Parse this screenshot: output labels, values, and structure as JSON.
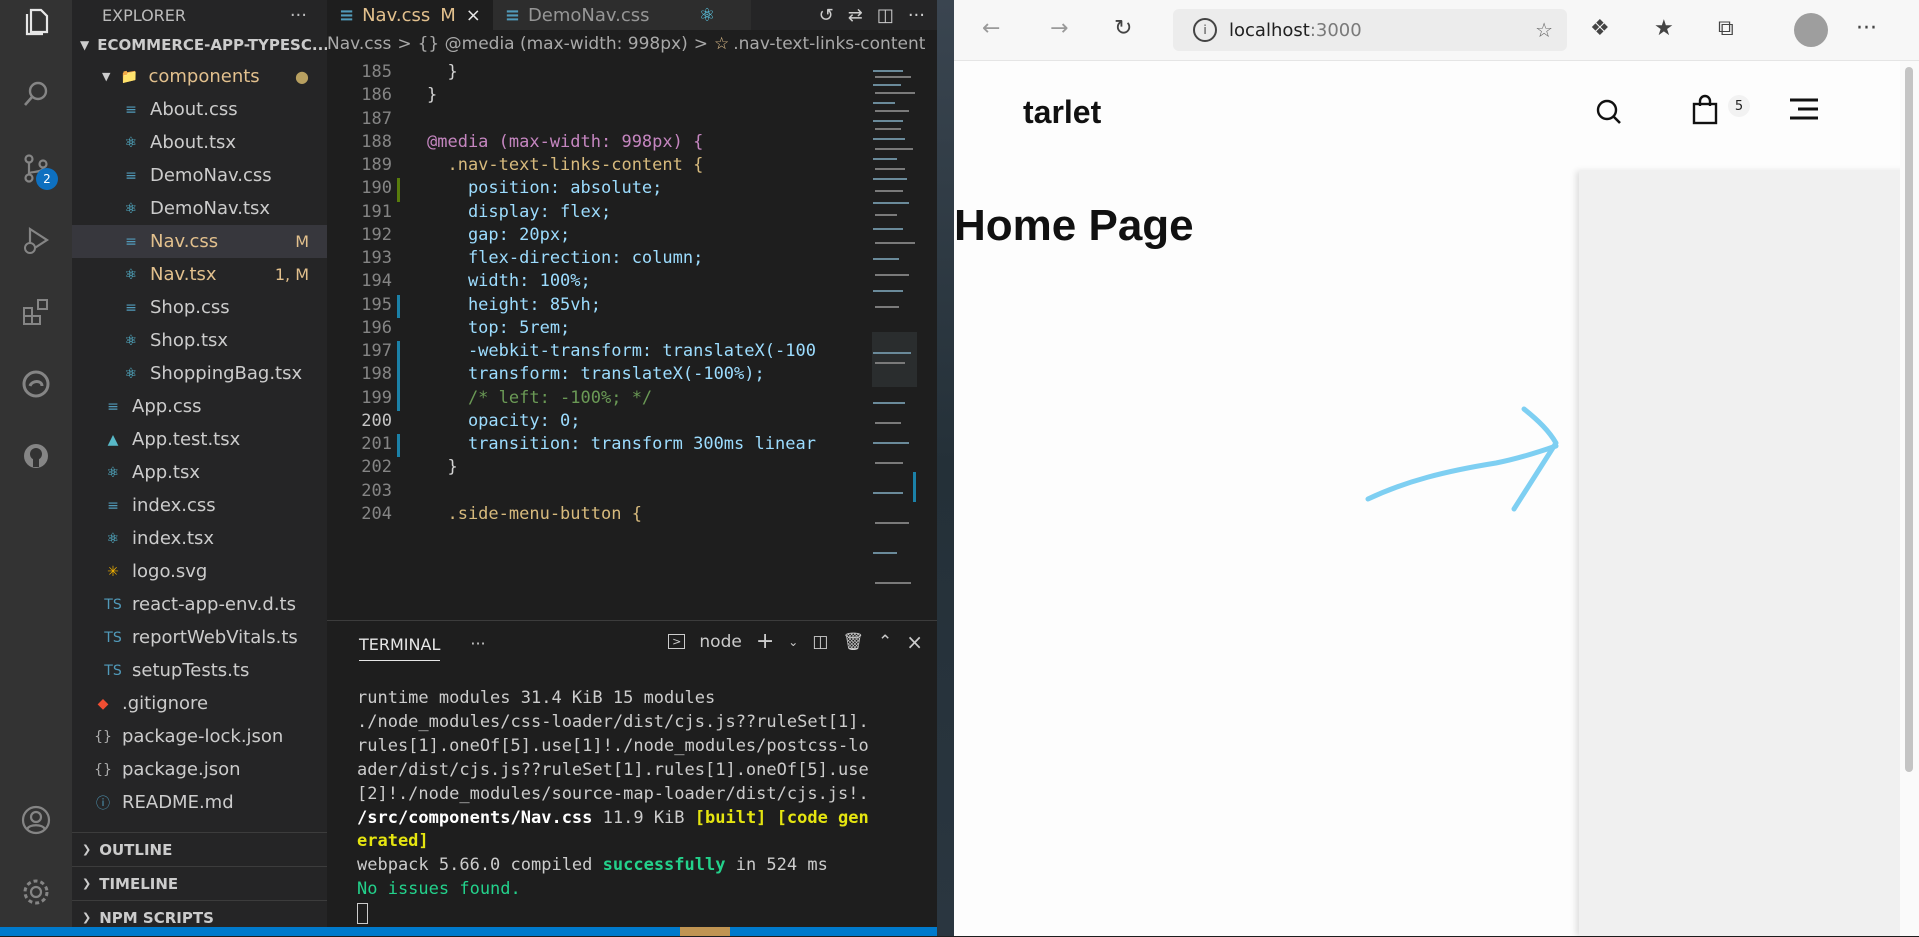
{
  "explorer": {
    "title": "EXPLORER",
    "more": "···",
    "project": "ECOMMERCE-APP-TYPESC...",
    "files": [
      {
        "name": "components",
        "type": "folder",
        "status": "●"
      },
      {
        "name": "About.css",
        "type": "css",
        "status": ""
      },
      {
        "name": "About.tsx",
        "type": "react",
        "status": ""
      },
      {
        "name": "DemoNav.css",
        "type": "css",
        "status": ""
      },
      {
        "name": "DemoNav.tsx",
        "type": "react",
        "status": ""
      },
      {
        "name": "Nav.css",
        "type": "css",
        "status": "M"
      },
      {
        "name": "Nav.tsx",
        "type": "react",
        "status": "1, M"
      },
      {
        "name": "Shop.css",
        "type": "css",
        "status": ""
      },
      {
        "name": "Shop.tsx",
        "type": "react",
        "status": ""
      },
      {
        "name": "ShoppingBag.tsx",
        "type": "react",
        "status": ""
      },
      {
        "name": "App.css",
        "type": "css",
        "status": ""
      },
      {
        "name": "App.test.tsx",
        "type": "test",
        "status": ""
      },
      {
        "name": "App.tsx",
        "type": "react",
        "status": ""
      },
      {
        "name": "index.css",
        "type": "css",
        "status": ""
      },
      {
        "name": "index.tsx",
        "type": "react",
        "status": ""
      },
      {
        "name": "logo.svg",
        "type": "svg",
        "status": ""
      },
      {
        "name": "react-app-env.d.ts",
        "type": "ts",
        "status": ""
      },
      {
        "name": "reportWebVitals.ts",
        "type": "ts",
        "status": ""
      },
      {
        "name": "setupTests.ts",
        "type": "ts",
        "status": ""
      },
      {
        "name": ".gitignore",
        "type": "git",
        "status": ""
      },
      {
        "name": "package-lock.json",
        "type": "json",
        "status": ""
      },
      {
        "name": "package.json",
        "type": "json",
        "status": ""
      },
      {
        "name": "README.md",
        "type": "info",
        "status": ""
      }
    ],
    "sections": [
      "OUTLINE",
      "TIMELINE",
      "NPM SCRIPTS"
    ]
  },
  "activity": {
    "scm_badge": "2"
  },
  "editor": {
    "tabs": [
      {
        "label": "Nav.css",
        "status": "M",
        "close": "×"
      },
      {
        "label": "DemoNav.css",
        "status": "",
        "close": ""
      }
    ],
    "breadcrumb": {
      "file": "Nav.css",
      "sep": ">",
      "media": "{} @media (max-width: 998px)",
      "selector": ".nav-text-links-content"
    },
    "lines": [
      {
        "n": "185",
        "text": "  }"
      },
      {
        "n": "186",
        "text": "}"
      },
      {
        "n": "187",
        "text": ""
      },
      {
        "n": "188",
        "text": "@media (max-width: 998px) {"
      },
      {
        "n": "189",
        "text": "  .nav-text-links-content {"
      },
      {
        "n": "190",
        "text": "    position: absolute;"
      },
      {
        "n": "191",
        "text": "    display: flex;"
      },
      {
        "n": "192",
        "text": "    gap: 20px;"
      },
      {
        "n": "193",
        "text": "    flex-direction: column;"
      },
      {
        "n": "194",
        "text": "    width: 100%;"
      },
      {
        "n": "195",
        "text": "    height: 85vh;"
      },
      {
        "n": "196",
        "text": "    top: 5rem;"
      },
      {
        "n": "197",
        "text": "    -webkit-transform: translateX(-100"
      },
      {
        "n": "198",
        "text": "    transform: translateX(-100%);"
      },
      {
        "n": "199",
        "text": "    /* left: -100%; */"
      },
      {
        "n": "200",
        "text": "    opacity: 0;"
      },
      {
        "n": "201",
        "text": "    transition: transform 300ms linear"
      },
      {
        "n": "202",
        "text": "  }"
      },
      {
        "n": "203",
        "text": ""
      },
      {
        "n": "204",
        "text": "  .side-menu-button {"
      }
    ]
  },
  "terminal": {
    "tab": "TERMINAL",
    "more": "···",
    "shell": "node",
    "lines": [
      "runtime modules 31.4 KiB 15 modules",
      "./node_modules/css-loader/dist/cjs.js??ruleSet[1].",
      "rules[1].oneOf[5].use[1]!./node_modules/postcss-lo",
      "ader/dist/cjs.js??ruleSet[1].rules[1].oneOf[5].use",
      "[2]!./node_modules/source-map-loader/dist/cjs.js!."
    ],
    "built_path": "/src/components/Nav.css",
    "built_size": " 11.9 KiB ",
    "built_tags": "[built] [code gen",
    "built_tags2": "erated]",
    "compiled_pre": "webpack 5.66.0 compiled ",
    "compiled_word": "successfully",
    "compiled_post": " in 524 ms",
    "no_issues": "No issues found."
  },
  "browser": {
    "host": "localhost",
    "port": ":3000",
    "brand": "tarlet",
    "bag_count": "5",
    "page_title": "Home Page"
  }
}
